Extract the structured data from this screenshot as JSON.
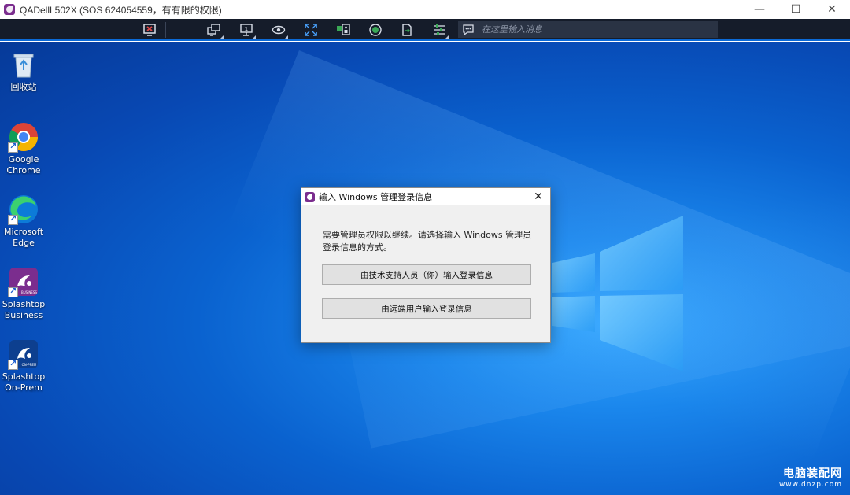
{
  "window": {
    "title": "QADellL502X (SOS 624054559，有有限的权限)",
    "minimize": "—",
    "maximize": "☐",
    "close": "✕"
  },
  "toolbar": {
    "buttons": [
      {
        "name": "disconnect-icon"
      },
      {
        "name": "switch-monitor-icon"
      },
      {
        "name": "monitor-1-icon",
        "label": "1"
      },
      {
        "name": "view-eye-icon"
      },
      {
        "name": "fullscreen-icon"
      },
      {
        "name": "ctrl-alt-del-icon"
      },
      {
        "name": "record-icon"
      },
      {
        "name": "file-transfer-icon"
      },
      {
        "name": "settings-sliders-icon"
      }
    ],
    "chat_placeholder": "在这里输入消息"
  },
  "desktop": {
    "icons": [
      {
        "label": "回收站"
      },
      {
        "label": "Google Chrome"
      },
      {
        "label": "Microsoft Edge"
      },
      {
        "label": "Splashtop Business",
        "badge": "BUSINESS"
      },
      {
        "label": "Splashtop On-Prem",
        "badge": "ON-PREM"
      }
    ]
  },
  "dialog": {
    "title": "输入 Windows 管理登录信息",
    "close": "✕",
    "message": "需要管理员权限以继续。请选择输入 Windows 管理员登录信息的方式。",
    "button_tech": "由技术支持人员（你）输入登录信息",
    "button_remote": "由远端用户输入登录信息"
  },
  "watermark": {
    "main": "电脑装配网",
    "sub": "www.dnzp.com"
  },
  "colors": {
    "toolbar_bg": "#151c2a",
    "accent": "#0b6ad8",
    "splashtop_purple": "#7b2d8e"
  }
}
